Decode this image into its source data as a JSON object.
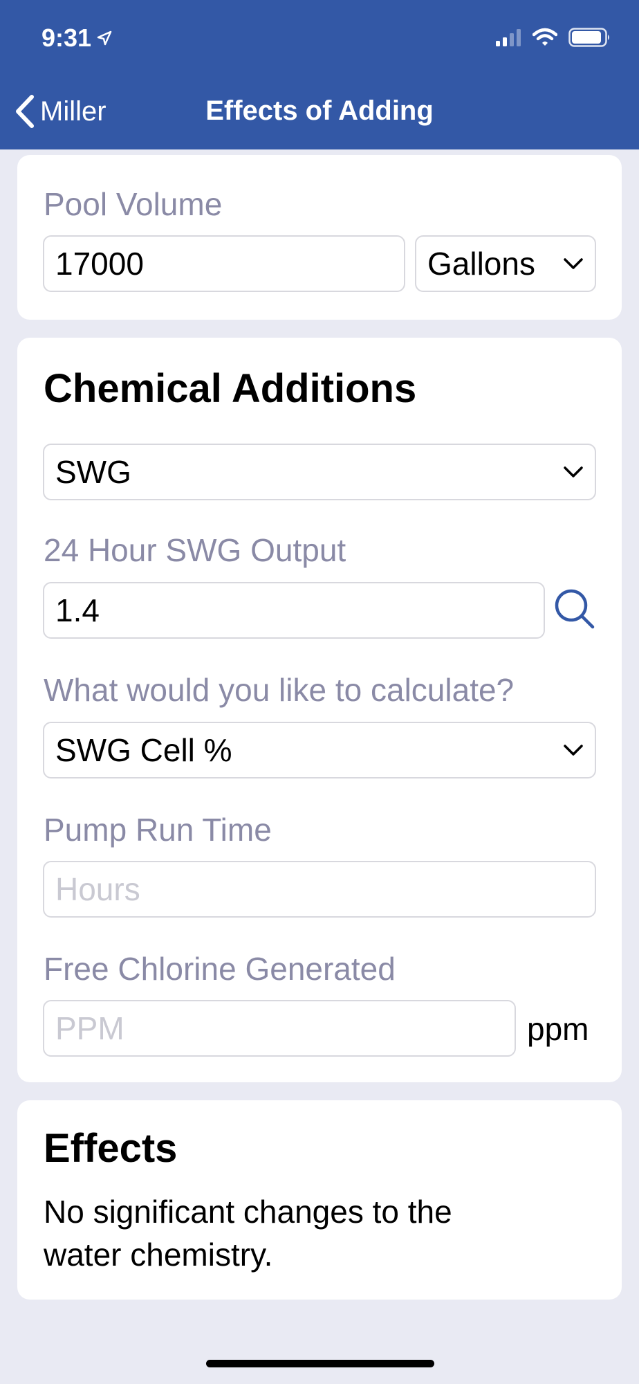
{
  "status_bar": {
    "time": "9:31"
  },
  "nav": {
    "back_label": "Miller",
    "title": "Effects of Adding"
  },
  "pool_volume": {
    "label": "Pool Volume",
    "value": "17000",
    "unit": "Gallons"
  },
  "chemical_additions": {
    "title": "Chemical Additions",
    "chemical": "SWG",
    "output_label": "24 Hour SWG Output",
    "output_value": "1.4",
    "calculate_label": "What would you like to calculate?",
    "calculate_value": "SWG Cell %",
    "pump_label": "Pump Run Time",
    "pump_placeholder": "Hours",
    "fc_label": "Free Chlorine Generated",
    "fc_placeholder": "PPM",
    "fc_unit": "ppm"
  },
  "effects": {
    "title": "Effects",
    "line1": "No significant changes to the",
    "line2": "water chemistry."
  },
  "colors": {
    "header": "#3358a6",
    "background": "#e9eaf3",
    "label": "#8a8aa6",
    "accent": "#3358a6"
  }
}
